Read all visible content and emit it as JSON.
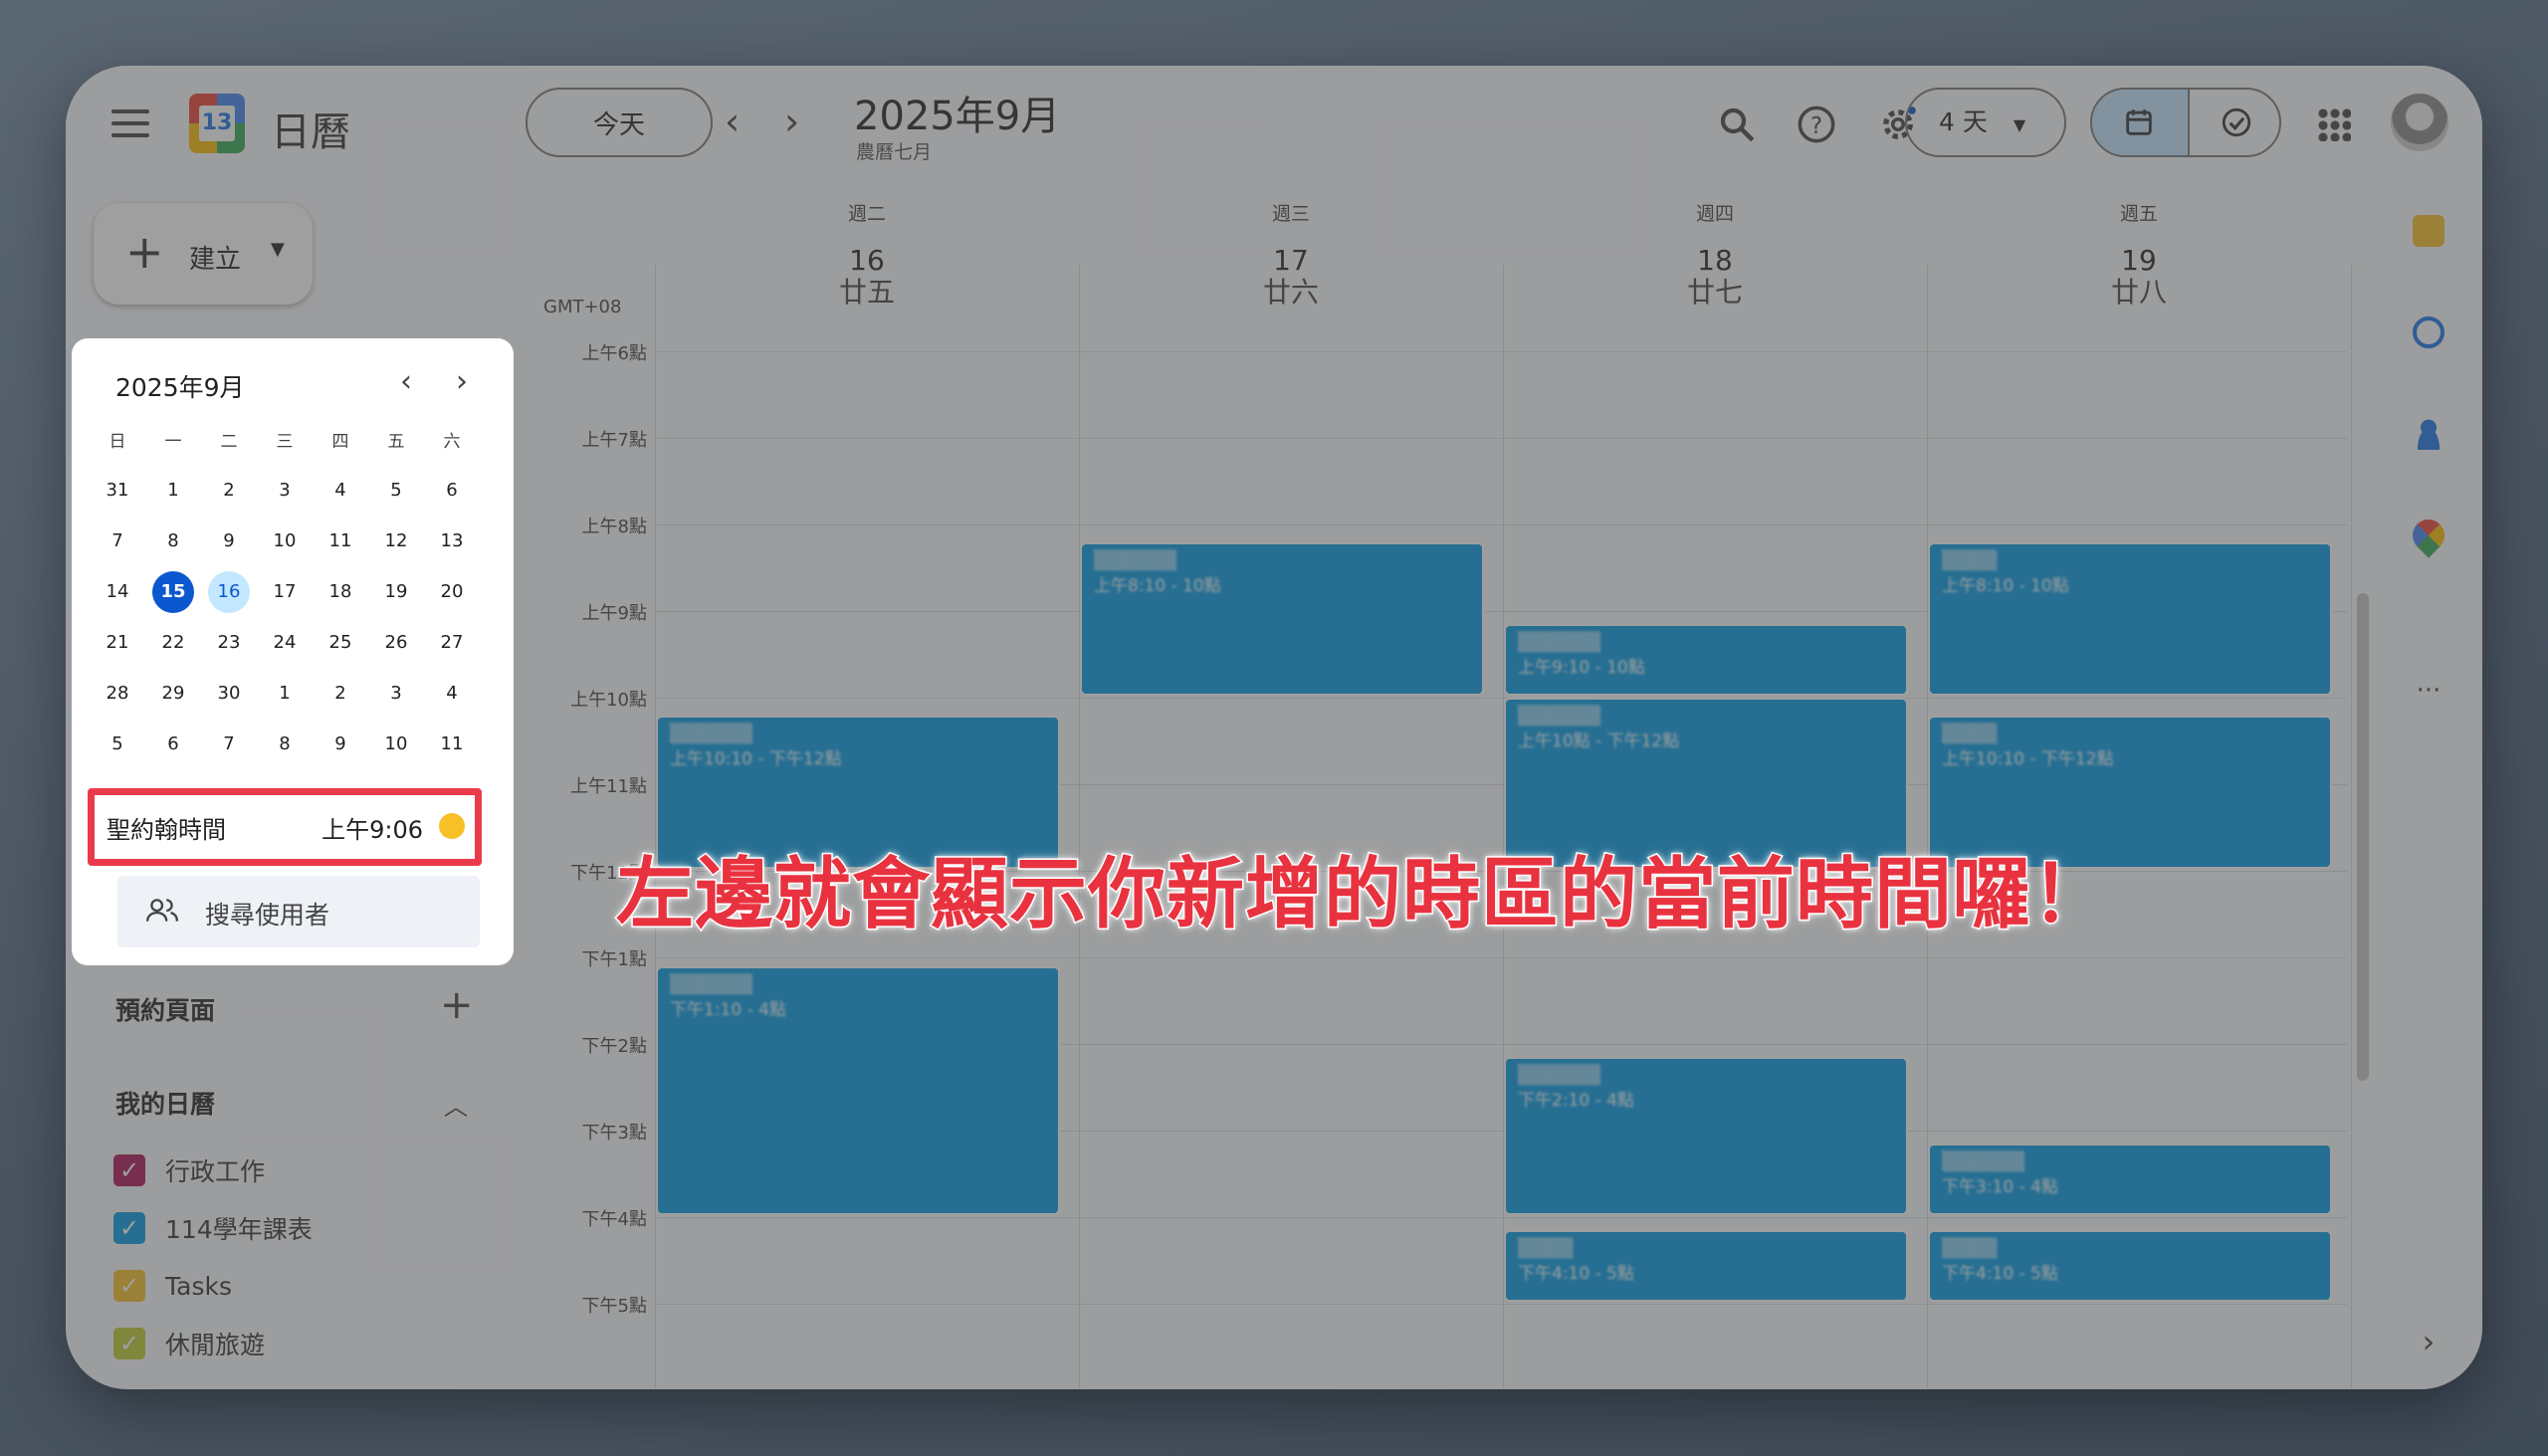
{
  "header": {
    "app_title": "日曆",
    "logo_number": "13",
    "today_button": "今天",
    "prev_icon": "chevron-left-icon",
    "next_icon": "chevron-right-icon",
    "month_title": "2025年9月",
    "lunar_month": "農曆七月",
    "view_selector": "4 天",
    "icons": [
      "search-icon",
      "help-icon",
      "settings-icon",
      "calendar-view-icon",
      "tasks-view-icon",
      "apps-grid-icon"
    ]
  },
  "create": {
    "label": "建立"
  },
  "mini_calendar": {
    "title": "2025年9月",
    "weekdays": [
      "日",
      "一",
      "二",
      "三",
      "四",
      "五",
      "六"
    ],
    "weeks": [
      [
        "31",
        "1",
        "2",
        "3",
        "4",
        "5",
        "6"
      ],
      [
        "7",
        "8",
        "9",
        "10",
        "11",
        "12",
        "13"
      ],
      [
        "14",
        "15",
        "16",
        "17",
        "18",
        "19",
        "20"
      ],
      [
        "21",
        "22",
        "23",
        "24",
        "25",
        "26",
        "27"
      ],
      [
        "28",
        "29",
        "30",
        "1",
        "2",
        "3",
        "4"
      ],
      [
        "5",
        "6",
        "7",
        "8",
        "9",
        "10",
        "11"
      ]
    ],
    "selected_day": "15",
    "highlighted_day": "16"
  },
  "timezone": {
    "name": "聖約翰時間",
    "time": "上午9:06"
  },
  "search_users": {
    "placeholder": "搜尋使用者"
  },
  "booking": {
    "label": "預約頁面"
  },
  "my_calendars": {
    "label": "我的日曆",
    "items": [
      {
        "label": "行政工作",
        "color": "#ad1457"
      },
      {
        "label": "114學年課表",
        "color": "#039be5"
      },
      {
        "label": "Tasks",
        "color": "#f6bf26"
      },
      {
        "label": "休閒旅遊",
        "color": "#c0ca33"
      }
    ]
  },
  "grid": {
    "timezone_label": "GMT+08",
    "days": [
      {
        "dow": "週二",
        "date": "16",
        "lunar": "廿五"
      },
      {
        "dow": "週三",
        "date": "17",
        "lunar": "廿六"
      },
      {
        "dow": "週四",
        "date": "18",
        "lunar": "廿七"
      },
      {
        "dow": "週五",
        "date": "19",
        "lunar": "廿八"
      }
    ],
    "hours": [
      "上午6點",
      "上午7點",
      "上午8點",
      "上午9點",
      "上午10點",
      "上午11點",
      "下午12點",
      "下午1點",
      "下午2點",
      "下午3點",
      "下午4點",
      "下午5點"
    ],
    "events": [
      {
        "day": 0,
        "start": 10.2,
        "end": 12.0,
        "title": "▒▒▒▒▒▒",
        "time": "上午10:10 - 下午12點"
      },
      {
        "day": 0,
        "start": 13.1,
        "end": 16.0,
        "title": "▒▒▒▒▒▒",
        "time": "下午1:10 - 4點"
      },
      {
        "day": 1,
        "start": 8.2,
        "end": 10.0,
        "title": "▒▒▒▒▒▒",
        "time": "上午8:10 - 10點"
      },
      {
        "day": 2,
        "start": 9.15,
        "end": 10.0,
        "title": "▒▒▒▒▒▒",
        "time": "上午9:10 - 10點"
      },
      {
        "day": 2,
        "start": 10.0,
        "end": 12.0,
        "title": "▒▒▒▒▒▒",
        "time": "上午10點 - 下午12點"
      },
      {
        "day": 2,
        "start": 14.15,
        "end": 16.0,
        "title": "▒▒▒▒▒▒",
        "time": "下午2:10 - 4點"
      },
      {
        "day": 2,
        "start": 16.15,
        "end": 17.0,
        "title": "▒▒▒▒",
        "time": "下午4:10 - 5點"
      },
      {
        "day": 3,
        "start": 8.2,
        "end": 10.0,
        "title": "▒▒▒▒",
        "time": "上午8:10 - 10點"
      },
      {
        "day": 3,
        "start": 10.2,
        "end": 12.0,
        "title": "▒▒▒▒",
        "time": "上午10:10 - 下午12點"
      },
      {
        "day": 3,
        "start": 15.15,
        "end": 16.0,
        "title": "▒▒▒▒▒▒",
        "time": "下午3:10 - 4點"
      },
      {
        "day": 3,
        "start": 16.15,
        "end": 17.0,
        "title": "▒▒▒▒",
        "time": "下午4:10 - 5點"
      }
    ]
  },
  "annotation": {
    "text": "左邊就會顯示你新增的時區的當前時間囉！"
  },
  "side_panel_icons": [
    "keep-icon",
    "tasks-icon",
    "contacts-icon",
    "maps-icon",
    "more-icon",
    "expand-icon"
  ]
}
